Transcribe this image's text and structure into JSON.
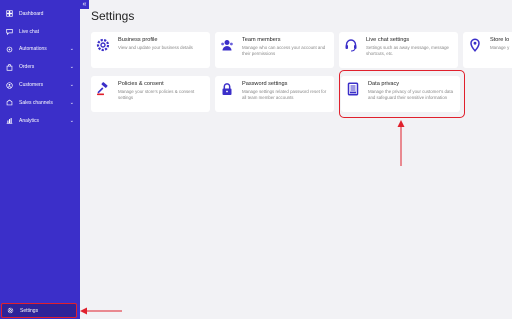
{
  "sidebar": {
    "collapse_glyph": "«",
    "items": [
      {
        "label": "Dashboard",
        "icon": "dashboard-icon",
        "chevron": ""
      },
      {
        "label": "Live chat",
        "icon": "chat-icon",
        "chevron": ""
      },
      {
        "label": "Automations",
        "icon": "automation-icon",
        "chevron": "⌄"
      },
      {
        "label": "Orders",
        "icon": "orders-icon",
        "chevron": "⌄"
      },
      {
        "label": "Customers",
        "icon": "customers-icon",
        "chevron": "⌄"
      },
      {
        "label": "Sales channels",
        "icon": "sales-channels-icon",
        "chevron": "⌄"
      },
      {
        "label": "Analytics",
        "icon": "analytics-icon",
        "chevron": "⌄"
      }
    ],
    "settings_label": "Settings"
  },
  "page": {
    "title": "Settings"
  },
  "cards": [
    {
      "title": "Business profile",
      "desc": "View and update your business details",
      "icon": "gear-icon"
    },
    {
      "title": "Team members",
      "desc": "Manage who can access your account and their permissions",
      "icon": "team-icon"
    },
    {
      "title": "Live chat settings",
      "desc": "Settings such as away message, message shortcuts, etc.",
      "icon": "headset-icon"
    },
    {
      "title": "Store lo",
      "desc": "Manage y",
      "icon": "location-pin-icon"
    },
    {
      "title": "Policies & consent",
      "desc": "Manage your store's policies & consent settings",
      "icon": "gavel-icon"
    },
    {
      "title": "Password settings",
      "desc": "Manage settings related password reset for all team member accounts",
      "icon": "lock-icon"
    },
    {
      "title": "Data privacy",
      "desc": "Manage the privacy of your customer's data and safeguard their sensitive information",
      "icon": "document-icon"
    }
  ],
  "colors": {
    "sidebar": "#3b2fc9",
    "accent": "#3b2fc9",
    "annotation": "#e0202c"
  }
}
